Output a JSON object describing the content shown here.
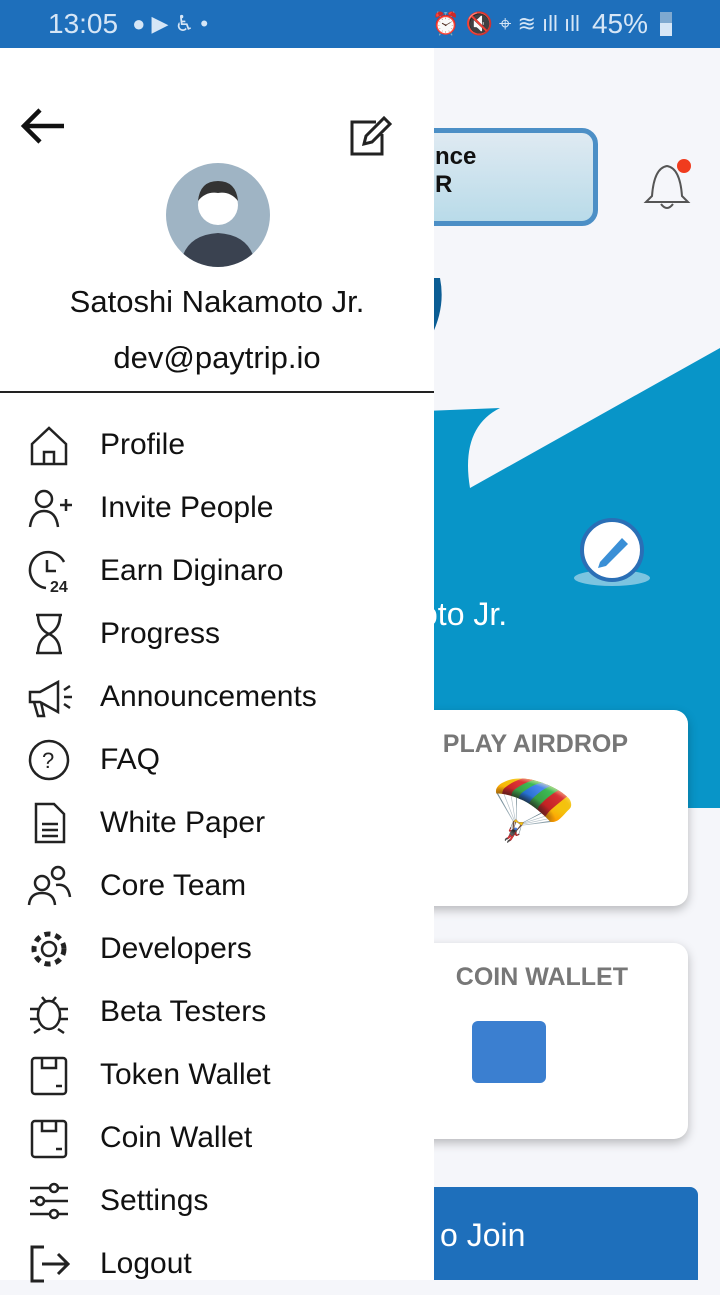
{
  "status_bar": {
    "time": "13:05",
    "battery": "45%",
    "icons": [
      "messenger-icon",
      "youtube-icon",
      "app-icon",
      "dot-icon",
      "alarm-icon",
      "mute-icon",
      "location-icon",
      "wifi-icon",
      "signal-icon",
      "signal-icon",
      "battery-icon"
    ]
  },
  "background": {
    "balance_label": "nce",
    "balance_sub": "R",
    "user_name_partial": "oto Jr.",
    "cards": [
      {
        "title": "PLAY AIRDROP"
      },
      {
        "title": "COIN WALLET"
      }
    ],
    "join_label": "o Join",
    "accent": "#1e6fbb",
    "notification_dot": "#f03c1e"
  },
  "drawer": {
    "user_name": "Satoshi Nakamoto Jr.",
    "email": "dev@paytrip.io",
    "menu": [
      {
        "label": "Profile",
        "icon": "home-icon"
      },
      {
        "label": "Invite People",
        "icon": "add-user-icon"
      },
      {
        "label": "Earn Diginaro",
        "icon": "clock-24-icon"
      },
      {
        "label": "Progress",
        "icon": "hourglass-icon"
      },
      {
        "label": "Announcements",
        "icon": "megaphone-icon"
      },
      {
        "label": "FAQ",
        "icon": "question-icon"
      },
      {
        "label": "White Paper",
        "icon": "document-icon"
      },
      {
        "label": "Core Team",
        "icon": "team-icon"
      },
      {
        "label": "Developers",
        "icon": "gear-icon"
      },
      {
        "label": "Beta Testers",
        "icon": "bug-icon"
      },
      {
        "label": "Token Wallet",
        "icon": "wallet-icon"
      },
      {
        "label": "Coin Wallet",
        "icon": "wallet-icon"
      },
      {
        "label": "Settings",
        "icon": "sliders-icon"
      },
      {
        "label": "Logout",
        "icon": "logout-icon"
      }
    ]
  }
}
